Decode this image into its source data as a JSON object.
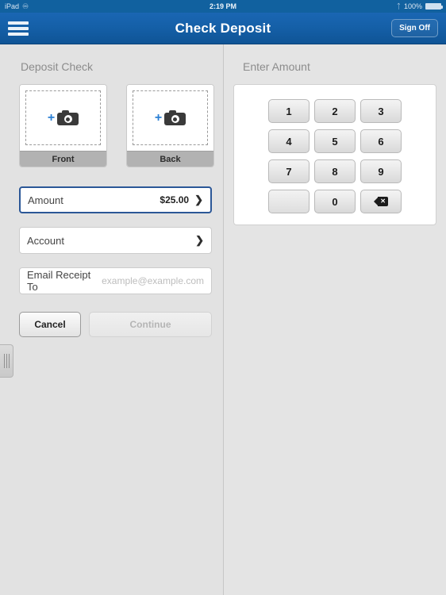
{
  "status_bar": {
    "device": "iPad",
    "sync_icon": "sync-icon",
    "time": "2:19 PM",
    "bluetooth_icon": "bluetooth-icon",
    "battery_percent": "100%"
  },
  "nav": {
    "menu_icon": "hamburger-menu-icon",
    "title": "Check Deposit",
    "sign_off_label": "Sign Off"
  },
  "left_pane": {
    "title": "Deposit Check",
    "captures": [
      {
        "label": "Front",
        "icon": "camera-add-icon"
      },
      {
        "label": "Back",
        "icon": "camera-add-icon"
      }
    ],
    "fields": {
      "amount": {
        "label": "Amount",
        "value": "$25.00"
      },
      "account": {
        "label": "Account",
        "value": ""
      },
      "email": {
        "label": "Email Receipt To",
        "placeholder": "example@example.com",
        "value": ""
      }
    },
    "buttons": {
      "cancel": "Cancel",
      "continue": "Continue"
    },
    "drag_handle": "panel-resize-handle"
  },
  "right_pane": {
    "title": "Enter Amount",
    "keypad": [
      {
        "key": "1",
        "type": "digit"
      },
      {
        "key": "2",
        "type": "digit"
      },
      {
        "key": "3",
        "type": "digit"
      },
      {
        "key": "4",
        "type": "digit"
      },
      {
        "key": "5",
        "type": "digit"
      },
      {
        "key": "6",
        "type": "digit"
      },
      {
        "key": "7",
        "type": "digit"
      },
      {
        "key": "8",
        "type": "digit"
      },
      {
        "key": "9",
        "type": "digit"
      },
      {
        "key": "",
        "type": "blank"
      },
      {
        "key": "0",
        "type": "digit"
      },
      {
        "key": "",
        "type": "backspace"
      }
    ]
  },
  "colors": {
    "nav_blue": "#1560a8",
    "accent_blue": "#2b5797",
    "plus_blue": "#2a7fd4",
    "page_bg": "#e3e3e3"
  }
}
